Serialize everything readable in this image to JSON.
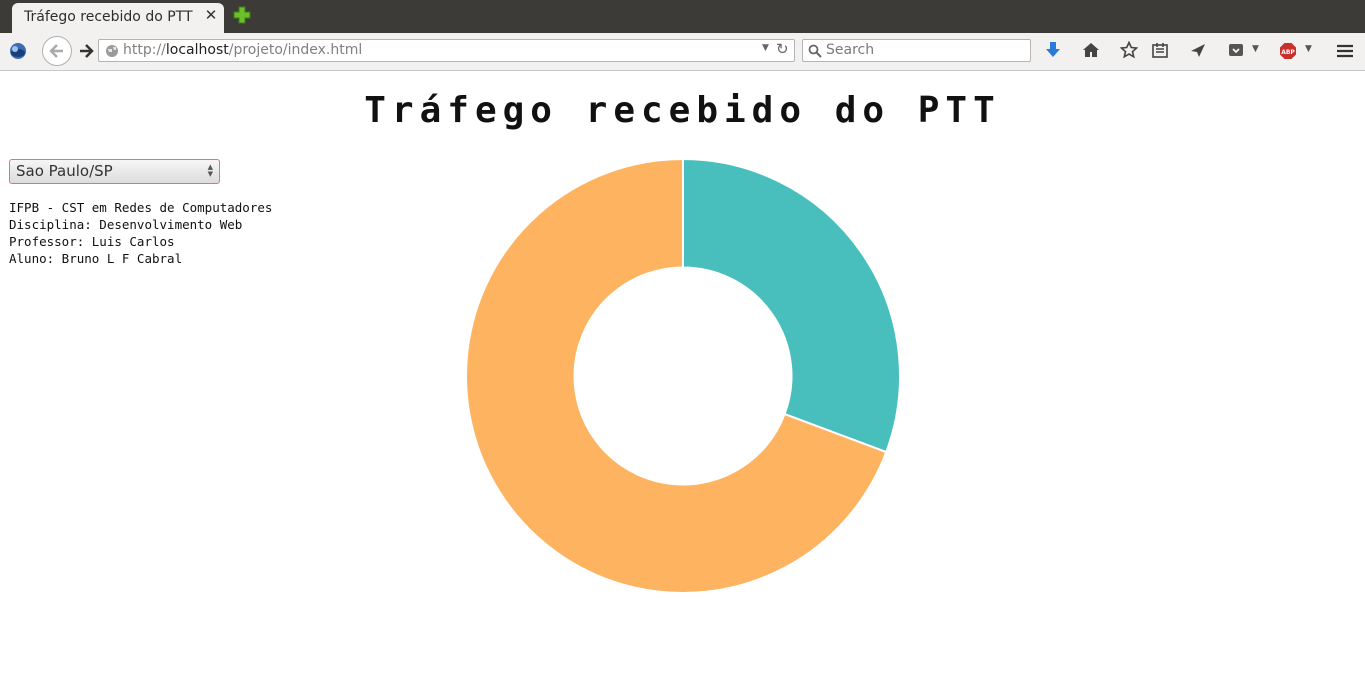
{
  "browser": {
    "tab_title": "Tráfego recebido do PTT",
    "url_prefix": "http://",
    "url_host": "localhost",
    "url_path": "/projeto/index.html",
    "search_placeholder": "Search"
  },
  "page": {
    "title": "Tráfego recebido do PTT",
    "location_select": {
      "selected": "Sao Paulo/SP"
    },
    "info_lines": [
      "IFPB - CST em Redes de Computadores",
      "Disciplina: Desenvolvimento Web",
      "Professor: Luis Carlos",
      "Aluno: Bruno L F Cabral"
    ]
  },
  "chart_data": {
    "type": "pie",
    "title": "",
    "inner_radius_ratio": 0.5,
    "slices": [
      {
        "value": 30.7,
        "color": "#48bfbc"
      },
      {
        "value": 69.3,
        "color": "#fdb35f"
      }
    ]
  }
}
